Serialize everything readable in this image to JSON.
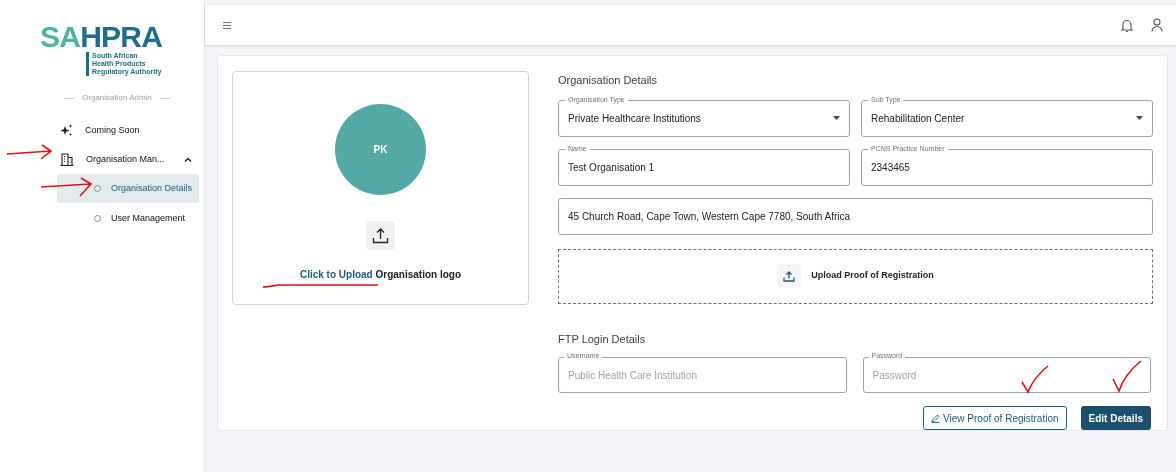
{
  "logo": {
    "letters_primary": "SA",
    "letters_secondary": "HPRA",
    "subtitle": [
      "South African",
      "Health Products",
      "Regulatory Authority"
    ]
  },
  "sidebar": {
    "section": "Organisation Admin",
    "items": [
      {
        "kind": "link",
        "label": "Coming Soon"
      },
      {
        "kind": "group",
        "label": "Organisation Man...",
        "expanded": true,
        "children": [
          {
            "label": "Organisation Details",
            "selected": true
          },
          {
            "label": "User Management",
            "selected": false
          }
        ]
      }
    ]
  },
  "logo_panel": {
    "initials": "PK",
    "upload_link": "Click to Upload",
    "upload_text": "Organisation logo"
  },
  "organisation": {
    "title": "Organisation Details",
    "fields": [
      {
        "kind": "select",
        "label": "Organisation Type",
        "value": "Private Healthcare Institutions"
      },
      {
        "kind": "select",
        "label": "Sub Type",
        "value": "Rehabilitation Center"
      },
      {
        "kind": "text",
        "label": "Name",
        "value": "Test Organisation 1"
      },
      {
        "kind": "text",
        "label": "PCNS Practice Number",
        "value": "2343465"
      },
      {
        "kind": "wide",
        "value": "45 Church Road, Cape Town, Western Cape 7780, South Africa"
      }
    ],
    "upload": "Upload Proof of Registration"
  },
  "ftp": {
    "title": "FTP Login Details",
    "fields": [
      {
        "label": "Username",
        "placeholder": "Public Health Care Institution"
      },
      {
        "label": "Password",
        "placeholder": "Password"
      }
    ]
  },
  "buttons": [
    {
      "kind": "outline",
      "label": "View Proof of Registration"
    },
    {
      "kind": "primary",
      "label": "Edit Details"
    }
  ]
}
